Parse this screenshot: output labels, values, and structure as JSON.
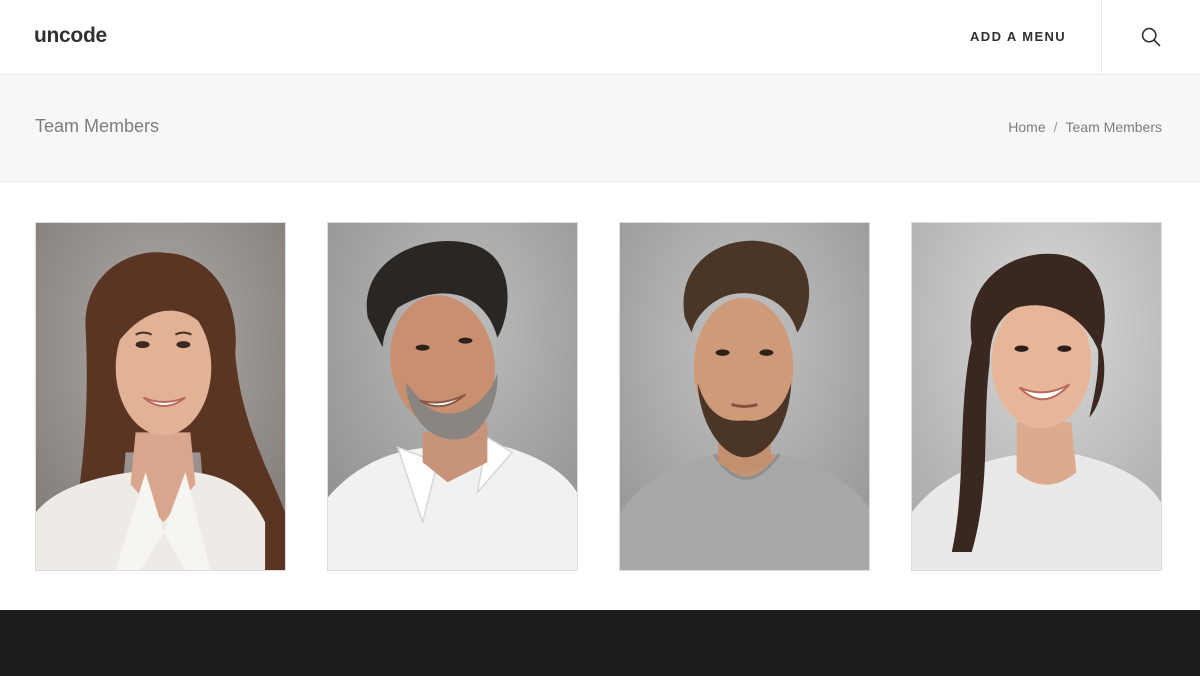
{
  "header": {
    "logo": "uncode",
    "menu_label": "ADD A MENU",
    "search_icon": "search-icon"
  },
  "title_bar": {
    "title": "Team Members",
    "breadcrumb": [
      {
        "label": "Home"
      },
      {
        "label": "/"
      },
      {
        "label": "Team Members"
      }
    ]
  },
  "team": {
    "members": [
      {
        "photo": "portrait-woman-long-hair"
      },
      {
        "photo": "portrait-man-grey-beard"
      },
      {
        "photo": "portrait-man-short-beard"
      },
      {
        "photo": "portrait-woman-curly-hair"
      }
    ]
  },
  "colors": {
    "text": "#303133",
    "muted": "#7b7d80",
    "title_band": "#f7f7f7",
    "footer": "#1b1d1f"
  }
}
